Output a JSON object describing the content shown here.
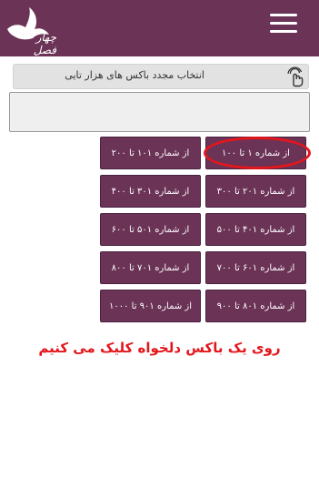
{
  "header": {
    "menu_icon": "hamburger-menu-icon",
    "logo_icon": "bird-logo-icon",
    "logo_text": "چهار فصل"
  },
  "selector": {
    "label": "انتخاب مجدد باکس های هزار تایی",
    "icon": "touch-hand-icon"
  },
  "search": {
    "value": "",
    "placeholder": ""
  },
  "range_buttons": [
    {
      "label": "از شماره ۱ تا ۱۰۰"
    },
    {
      "label": "از شماره ۱۰۱ تا ۲۰۰"
    },
    {
      "label": "از شماره ۲۰۱ تا ۳۰۰"
    },
    {
      "label": "از شماره ۳۰۱ تا ۴۰۰"
    },
    {
      "label": "از شماره ۴۰۱ تا ۵۰۰"
    },
    {
      "label": "از شماره ۵۰۱ تا ۶۰۰"
    },
    {
      "label": "از شماره ۶۰۱ تا ۷۰۰"
    },
    {
      "label": "از شماره ۷۰۱ تا ۸۰۰"
    },
    {
      "label": "از شماره ۸۰۱ تا ۹۰۰"
    },
    {
      "label": "از شماره ۹۰۱ تا ۱۰۰۰"
    }
  ],
  "annotation": {
    "instruction": "روی یک باکس دلخواه کلیک می کنیم",
    "highlight_color": "#e3161c"
  },
  "colors": {
    "brand": "#6b3356",
    "accent": "#e3161c"
  }
}
